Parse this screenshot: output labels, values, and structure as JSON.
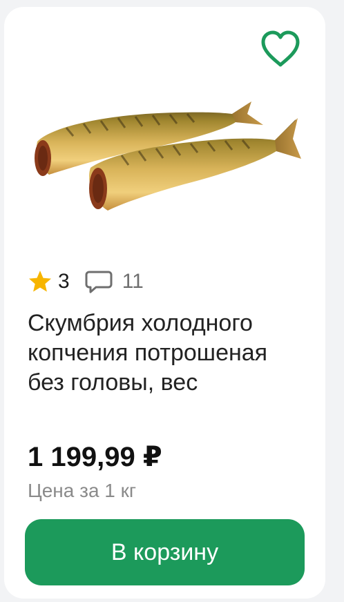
{
  "product": {
    "favorite_icon": "heart-outline-icon",
    "image_alt": "Скумбрия",
    "rating": "3",
    "review_count": "11",
    "title": "Скумбрия холодного копчения потрошеная без головы, вес",
    "price": "1 199,99 ₽",
    "price_unit": "Цена за 1 кг",
    "cart_button_label": "В корзину"
  },
  "icons": {
    "star": "star-icon",
    "reviews": "speech-bubble-icon"
  },
  "colors": {
    "accent": "#1c9a5b",
    "star": "#f7b500",
    "heart": "#1c9a5b",
    "card_background": "#ffffff",
    "page_background": "#f2f3f5"
  }
}
